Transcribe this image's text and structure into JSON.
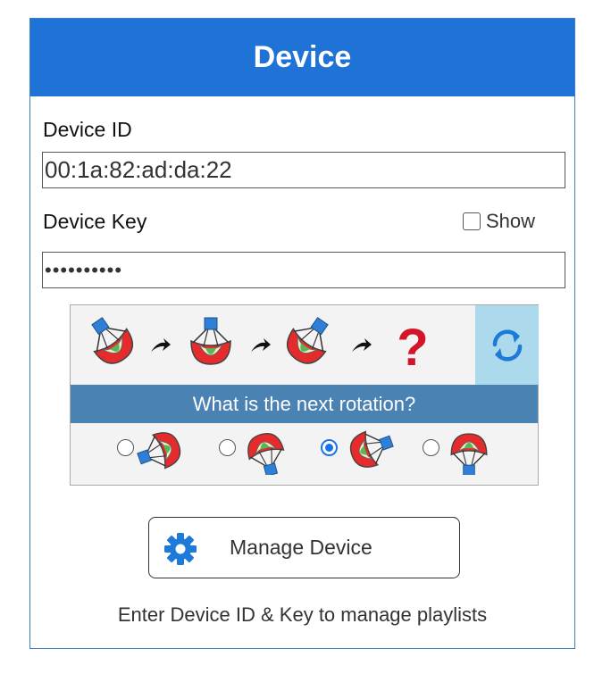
{
  "header": {
    "title": "Device"
  },
  "device_id": {
    "label": "Device ID",
    "value": "00:1a:82:ad:da:22"
  },
  "device_key": {
    "label": "Device Key",
    "value": "••••••••••",
    "show_label": "Show",
    "show_checked": false
  },
  "captcha": {
    "sequence_icons": [
      "parachute-icon",
      "arrow-right-icon",
      "parachute-icon",
      "arrow-right-icon",
      "parachute-icon",
      "arrow-right-icon",
      "question-mark-icon"
    ],
    "question_mark": "?",
    "question": "What is the next rotation?",
    "refresh_icon": "refresh-icon",
    "options": [
      {
        "icon": "parachute-icon",
        "selected": false
      },
      {
        "icon": "parachute-icon",
        "selected": false
      },
      {
        "icon": "parachute-icon",
        "selected": true
      },
      {
        "icon": "parachute-icon",
        "selected": false
      }
    ]
  },
  "manage_button": {
    "icon": "gear-icon",
    "label": "Manage Device"
  },
  "footer": {
    "note": "Enter Device ID & Key to manage playlists"
  },
  "colors": {
    "header": "#1f72d6",
    "question_bar": "#4a82b4",
    "refresh_bg": "#acd9eb",
    "accent": "#1a73e8",
    "question_mark": "#d4142a"
  }
}
